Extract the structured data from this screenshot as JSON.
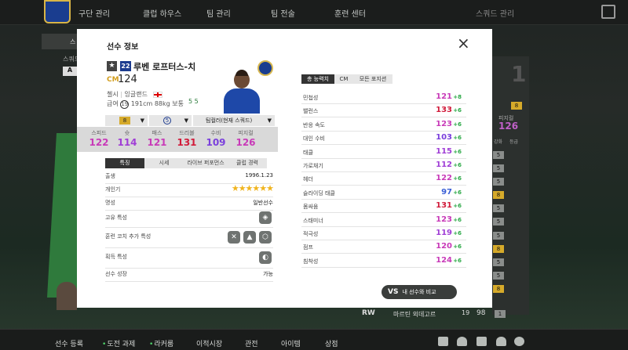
{
  "topnav": {
    "items": [
      "구단 관리",
      "클럽 하우스",
      "팀 관리",
      "팀 전술",
      "훈련 센터"
    ],
    "right_label": "스쿼드 관리"
  },
  "background": {
    "panel_label": "스",
    "left_a": "A",
    "left_small": "스쿼드",
    "right_card_num": "1",
    "right_ovr_label": "피지컬",
    "right_ovr_value": "126",
    "right_col_labels": [
      "강화",
      "등급"
    ],
    "right_badges": [
      "5",
      "5",
      "5",
      "8",
      "5",
      "5",
      "5",
      "5",
      "8",
      "5",
      "8",
      "8"
    ],
    "row_pos": "RW",
    "row_name": "마르틴 외데고르",
    "row_ovr": "98",
    "row_badge": "19",
    "row_num": "1"
  },
  "bottomnav": {
    "items": [
      "선수 등록",
      "도전 과제",
      "라커룸",
      "이적시장",
      "관전",
      "아이템",
      "상점"
    ]
  },
  "modal": {
    "title": "선수 정보",
    "close": "×",
    "player": {
      "star": "★",
      "season": "22",
      "name": "루벤 로프터스-치",
      "position": "CM",
      "ovr": "124",
      "club": "첼시",
      "nation": "잉글랜드",
      "salary_label": "급여",
      "salary": "19",
      "height": "191cm",
      "weight": "88kg",
      "body": "보통",
      "feet": "5 5"
    },
    "controls": {
      "enhance": "8",
      "skill": "5",
      "chem": "팀컬러(현재 스쿼드)"
    },
    "six_stats": [
      {
        "label": "스피드",
        "value": "122",
        "color": "#c83ab8"
      },
      {
        "label": "슛",
        "value": "114",
        "color": "#a03ed6"
      },
      {
        "label": "패스",
        "value": "121",
        "color": "#c83ab8"
      },
      {
        "label": "드리블",
        "value": "131",
        "color": "#d11b3a"
      },
      {
        "label": "수비",
        "value": "109",
        "color": "#7a3fdc"
      },
      {
        "label": "피지컬",
        "value": "126",
        "color": "#c83ab8"
      }
    ],
    "tabs": [
      "특징",
      "시세",
      "라이브 퍼포먼스",
      "클럽 경력"
    ],
    "details": {
      "birth_label": "출생",
      "birth": "1996.1.23",
      "skill_label": "개인기",
      "skill_stars": "★★★★★★",
      "fame_label": "명성",
      "fame": "일반선수",
      "unique_label": "고유 특성",
      "coach_label": "훈련 코치 추가 특성",
      "acquired_label": "획득 특성",
      "growth_label": "선수 성장",
      "growth": "가능"
    },
    "stat_tabs": [
      "총 능력치",
      "CM",
      "모든 포지션"
    ],
    "stats": [
      {
        "label": "민첩성",
        "value": "121",
        "bonus": "+8",
        "color": "#c83ab8"
      },
      {
        "label": "밸런스",
        "value": "133",
        "bonus": "+6",
        "color": "#d11b3a"
      },
      {
        "label": "반응 속도",
        "value": "123",
        "bonus": "+6",
        "color": "#c83ab8"
      },
      {
        "label": "대인 수비",
        "value": "103",
        "bonus": "+6",
        "color": "#7a3fdc"
      },
      {
        "label": "태클",
        "value": "115",
        "bonus": "+6",
        "color": "#a03ed6"
      },
      {
        "label": "가로채기",
        "value": "112",
        "bonus": "+6",
        "color": "#a03ed6"
      },
      {
        "label": "헤더",
        "value": "122",
        "bonus": "+6",
        "color": "#c83ab8"
      },
      {
        "label": "슬라이딩 태클",
        "value": "97",
        "bonus": "+6",
        "color": "#3a5fd6"
      },
      {
        "label": "몸싸움",
        "value": "131",
        "bonus": "+6",
        "color": "#d11b3a"
      },
      {
        "label": "스태미너",
        "value": "123",
        "bonus": "+6",
        "color": "#c83ab8"
      },
      {
        "label": "적극성",
        "value": "119",
        "bonus": "+6",
        "color": "#a03ed6"
      },
      {
        "label": "점프",
        "value": "120",
        "bonus": "+6",
        "color": "#c83ab8"
      },
      {
        "label": "침착성",
        "value": "124",
        "bonus": "+6",
        "color": "#c83ab8"
      }
    ],
    "compare_icon": "VS",
    "compare_label": "내 선수와 비교"
  }
}
